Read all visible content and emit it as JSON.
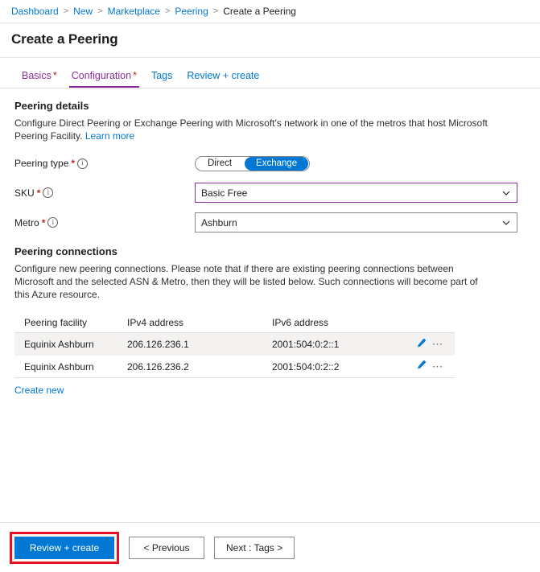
{
  "breadcrumb": {
    "items": [
      {
        "label": "Dashboard",
        "current": false
      },
      {
        "label": "New",
        "current": false
      },
      {
        "label": "Marketplace",
        "current": false
      },
      {
        "label": "Peering",
        "current": false
      },
      {
        "label": "Create a Peering",
        "current": true
      }
    ],
    "separator": ">"
  },
  "header": {
    "title": "Create a Peering"
  },
  "tabs": [
    {
      "label": "Basics",
      "required": "*",
      "state": "visited"
    },
    {
      "label": "Configuration",
      "required": "*",
      "state": "active"
    },
    {
      "label": "Tags",
      "required": "",
      "state": "default"
    },
    {
      "label": "Review + create",
      "required": "",
      "state": "default"
    }
  ],
  "peering_details": {
    "heading": "Peering details",
    "description": "Configure Direct Peering or Exchange Peering with Microsoft's network in one of the metros that host Microsoft Peering Facility.",
    "learn_more": "Learn more",
    "peering_type": {
      "label": "Peering type",
      "required": "*",
      "info_icon": "info-icon",
      "options": [
        "Direct",
        "Exchange"
      ],
      "selected": "Exchange"
    },
    "sku": {
      "label": "SKU",
      "required": "*",
      "info_icon": "info-icon",
      "value": "Basic Free",
      "chevron_icon": "chevron-down-icon"
    },
    "metro": {
      "label": "Metro",
      "required": "*",
      "info_icon": "info-icon",
      "value": "Ashburn",
      "chevron_icon": "chevron-down-icon"
    }
  },
  "peering_connections": {
    "heading": "Peering connections",
    "description": "Configure new peering connections. Please note that if there are existing peering connections between Microsoft and the selected ASN & Metro, then they will be listed below. Such connections will become part of this Azure resource.",
    "columns": [
      "Peering facility",
      "IPv4 address",
      "IPv6 address"
    ],
    "rows": [
      {
        "facility": "Equinix Ashburn",
        "ipv4": "206.126.236.1",
        "ipv6": "2001:504:0:2::1",
        "edit_icon": "pencil-icon",
        "more_icon": "ellipsis-icon"
      },
      {
        "facility": "Equinix Ashburn",
        "ipv4": "206.126.236.2",
        "ipv6": "2001:504:0:2::2",
        "edit_icon": "pencil-icon",
        "more_icon": "ellipsis-icon"
      }
    ],
    "create_new": "Create new"
  },
  "footer": {
    "review_create": "Review + create",
    "previous": "< Previous",
    "next": "Next : Tags >"
  },
  "colors": {
    "accent_blue": "#0078d4",
    "azure_purple": "#8a2f9c",
    "required_red": "#b4261a",
    "highlight_red": "#e81123",
    "row_alt": "#f3f2f1",
    "border_gray": "#8a8886"
  }
}
